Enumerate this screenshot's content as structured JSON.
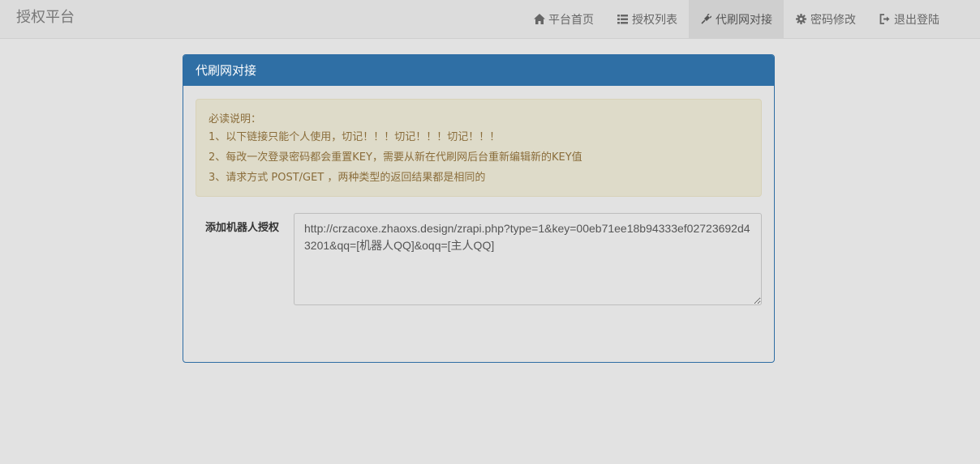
{
  "navbar": {
    "brand": "授权平台",
    "items": [
      {
        "label": "平台首页",
        "icon": "home-icon",
        "active": false
      },
      {
        "label": "授权列表",
        "icon": "list-icon",
        "active": false
      },
      {
        "label": "代刷网对接",
        "icon": "plug-icon",
        "active": true
      },
      {
        "label": "密码修改",
        "icon": "gear-icon",
        "active": false
      },
      {
        "label": "退出登陆",
        "icon": "logout-icon",
        "active": false
      }
    ]
  },
  "panel": {
    "title": "代刷网对接",
    "notice": {
      "heading": "必读说明：",
      "lines": [
        "1、以下链接只能个人使用，切记！！！切记！！！切记！！！",
        "2、每改一次登录密码都会重置KEY，需要从新在代刷网后台重新编辑新的KEY值",
        "3、请求方式 POST/GET ，两种类型的返回结果都是相同的"
      ]
    },
    "form": {
      "label": "添加机器人授权",
      "value": "http://crzacoxe.zhaoxs.design/zrapi.php?type=1&key=00eb71ee18b94333ef02723692d43201&qq=[机器人QQ]&oqq=[主人QQ]"
    }
  },
  "colors": {
    "panel_heading": "#2f6fa5",
    "alert_bg": "#dedbc9",
    "alert_text": "#8a6d3b",
    "page_bg": "#e2e2e2"
  }
}
